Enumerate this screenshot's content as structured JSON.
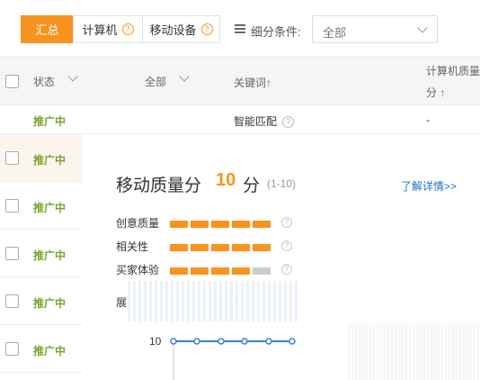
{
  "tabs": [
    {
      "label": "汇总",
      "active": true
    },
    {
      "label": "计算机",
      "active": false,
      "help": "?"
    },
    {
      "label": "移动设备",
      "active": false,
      "help": "?"
    }
  ],
  "filter": {
    "label": "细分条件:",
    "value": "全部"
  },
  "table": {
    "headers": {
      "status": "状态",
      "all": "全部",
      "keyword": "关键词↑",
      "pc_quality_line1": "计算机质量",
      "pc_quality_line2": "分 ↑"
    },
    "row1": {
      "status": "推广中",
      "keyword": "智能匹配",
      "pc_quality": "-"
    },
    "left_rows": [
      "推广中",
      "推广中",
      "推广中",
      "推广中",
      "推广中"
    ]
  },
  "popup": {
    "title": "移动质量分",
    "score": "10",
    "unit": "分",
    "range": "(1-10)",
    "more_link": "了解详情>>",
    "metrics": [
      {
        "label": "创意质量",
        "filled": 5,
        "total": 5
      },
      {
        "label": "相关性",
        "filled": 5,
        "total": 5
      },
      {
        "label": "买家体验",
        "filled": 4,
        "total": 5
      }
    ],
    "help": "?",
    "trend_label": "展",
    "trend_axis": "10",
    "colors": {
      "accent": "#f7931e",
      "bar_off": "#cccccc",
      "trend": "#3b7fd9",
      "status": "#7ba32c",
      "link": "#1a73c9"
    }
  }
}
